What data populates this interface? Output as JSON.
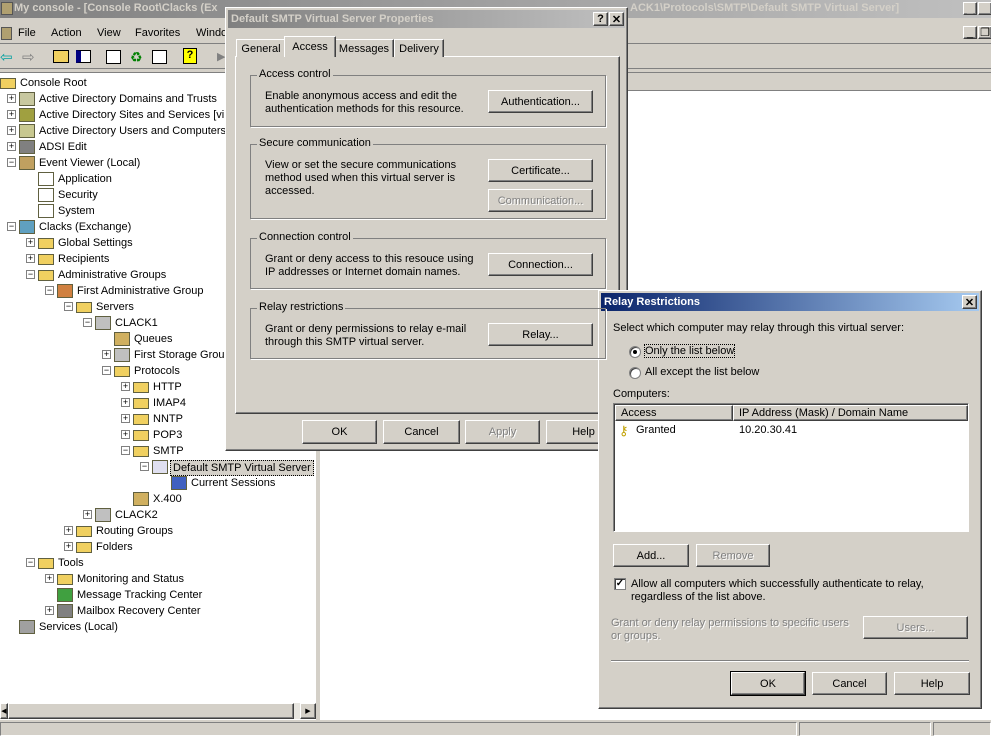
{
  "main": {
    "title_left": "My console - [Console Root\\Clacks (Ex",
    "title_right": "ACK1\\Protocols\\SMTP\\Default SMTP Virtual Server]",
    "menu": [
      "File",
      "Action",
      "View",
      "Favorites",
      "Windo"
    ],
    "toolbar": [
      "back-icon",
      "forward-icon",
      "up-folder-icon",
      "show-hide-tree-icon",
      "properties-icon",
      "refresh-icon",
      "export-list-icon",
      "help-icon"
    ]
  },
  "tree": [
    {
      "label": "Console Root",
      "depth": 0,
      "exp": "",
      "icon": "folder"
    },
    {
      "label": "Active Directory Domains and Trusts",
      "depth": 1,
      "exp": "+",
      "icon": "domains"
    },
    {
      "label": "Active Directory Sites and Services [vim",
      "depth": 1,
      "exp": "+",
      "icon": "sites"
    },
    {
      "label": "Active Directory Users and Computers [",
      "depth": 1,
      "exp": "+",
      "icon": "users"
    },
    {
      "label": "ADSI Edit",
      "depth": 1,
      "exp": "+",
      "icon": "adsi"
    },
    {
      "label": "Event Viewer (Local)",
      "depth": 1,
      "exp": "-",
      "icon": "event"
    },
    {
      "label": "Application",
      "depth": 2,
      "exp": "",
      "icon": "log"
    },
    {
      "label": "Security",
      "depth": 2,
      "exp": "",
      "icon": "log"
    },
    {
      "label": "System",
      "depth": 2,
      "exp": "",
      "icon": "log"
    },
    {
      "label": "Clacks (Exchange)",
      "depth": 1,
      "exp": "-",
      "icon": "exchange"
    },
    {
      "label": "Global Settings",
      "depth": 2,
      "exp": "+",
      "icon": "folder"
    },
    {
      "label": "Recipients",
      "depth": 2,
      "exp": "+",
      "icon": "folder"
    },
    {
      "label": "Administrative Groups",
      "depth": 2,
      "exp": "-",
      "icon": "folder"
    },
    {
      "label": "First Administrative Group",
      "depth": 3,
      "exp": "-",
      "icon": "admin"
    },
    {
      "label": "Servers",
      "depth": 4,
      "exp": "-",
      "icon": "folder"
    },
    {
      "label": "CLACK1",
      "depth": 5,
      "exp": "-",
      "icon": "server"
    },
    {
      "label": "Queues",
      "depth": 6,
      "exp": "",
      "icon": "queue"
    },
    {
      "label": "First Storage Group",
      "depth": 6,
      "exp": "+",
      "icon": "storage"
    },
    {
      "label": "Protocols",
      "depth": 6,
      "exp": "-",
      "icon": "folder"
    },
    {
      "label": "HTTP",
      "depth": 7,
      "exp": "+",
      "icon": "folder"
    },
    {
      "label": "IMAP4",
      "depth": 7,
      "exp": "+",
      "icon": "folder"
    },
    {
      "label": "NNTP",
      "depth": 7,
      "exp": "+",
      "icon": "folder"
    },
    {
      "label": "POP3",
      "depth": 7,
      "exp": "+",
      "icon": "folder"
    },
    {
      "label": "SMTP",
      "depth": 7,
      "exp": "-",
      "icon": "folder"
    },
    {
      "label": "Default SMTP Virtual Server",
      "depth": 8,
      "exp": "-",
      "icon": "vserver",
      "selected": true
    },
    {
      "label": "Current Sessions",
      "depth": 9,
      "exp": "",
      "icon": "sessions"
    },
    {
      "label": "X.400",
      "depth": 7,
      "exp": "",
      "icon": "x400"
    },
    {
      "label": "CLACK2",
      "depth": 5,
      "exp": "+",
      "icon": "server"
    },
    {
      "label": "Routing Groups",
      "depth": 4,
      "exp": "+",
      "icon": "folder"
    },
    {
      "label": "Folders",
      "depth": 4,
      "exp": "+",
      "icon": "folder"
    },
    {
      "label": "Tools",
      "depth": 2,
      "exp": "-",
      "icon": "folder"
    },
    {
      "label": "Monitoring and Status",
      "depth": 3,
      "exp": "+",
      "icon": "folder"
    },
    {
      "label": "Message Tracking Center",
      "depth": 3,
      "exp": "",
      "icon": "tracking"
    },
    {
      "label": "Mailbox Recovery Center",
      "depth": 3,
      "exp": "+",
      "icon": "mailbox"
    },
    {
      "label": "Services (Local)",
      "depth": 1,
      "exp": "",
      "icon": "services"
    }
  ],
  "props": {
    "title": "Default SMTP Virtual Server Properties",
    "tabs": [
      "General",
      "Access",
      "Messages",
      "Delivery"
    ],
    "active_tab": "Access",
    "groups": [
      {
        "title": "Access control",
        "text": "Enable anonymous access and edit the authentication methods for this resource.",
        "buttons": [
          {
            "label": "Authentication...",
            "enabled": true
          }
        ]
      },
      {
        "title": "Secure communication",
        "text": "View or set the secure communications method used when this virtual server is accessed.",
        "buttons": [
          {
            "label": "Certificate...",
            "enabled": true
          },
          {
            "label": "Communication...",
            "enabled": false
          }
        ]
      },
      {
        "title": "Connection control",
        "text": "Grant or deny access to this resouce using IP addresses or Internet domain names.",
        "buttons": [
          {
            "label": "Connection...",
            "enabled": true
          }
        ]
      },
      {
        "title": "Relay restrictions",
        "text": "Grant or deny permissions to relay e-mail through this SMTP virtual server.",
        "buttons": [
          {
            "label": "Relay...",
            "enabled": true
          }
        ]
      }
    ],
    "ok": "OK",
    "cancel": "Cancel",
    "apply": "Apply",
    "help": "Help"
  },
  "relay": {
    "title": "Relay Restrictions",
    "prompt": "Select which computer may relay through this virtual server:",
    "radio_only": "Only the list below",
    "radio_except": "All except the list below",
    "selected_radio": "only",
    "computers_label": "Computers:",
    "columns": [
      "Access",
      "IP Address (Mask) / Domain Name"
    ],
    "rows": [
      {
        "access": "Granted",
        "address": "10.20.30.41"
      }
    ],
    "add": "Add...",
    "remove": "Remove",
    "allow_auth": "Allow all computers which successfully authenticate to relay, regardless of the list above.",
    "allow_auth_checked": true,
    "grant_text": "Grant or deny relay permissions to specific users or groups.",
    "users": "Users...",
    "ok": "OK",
    "cancel": "Cancel",
    "help": "Help"
  }
}
